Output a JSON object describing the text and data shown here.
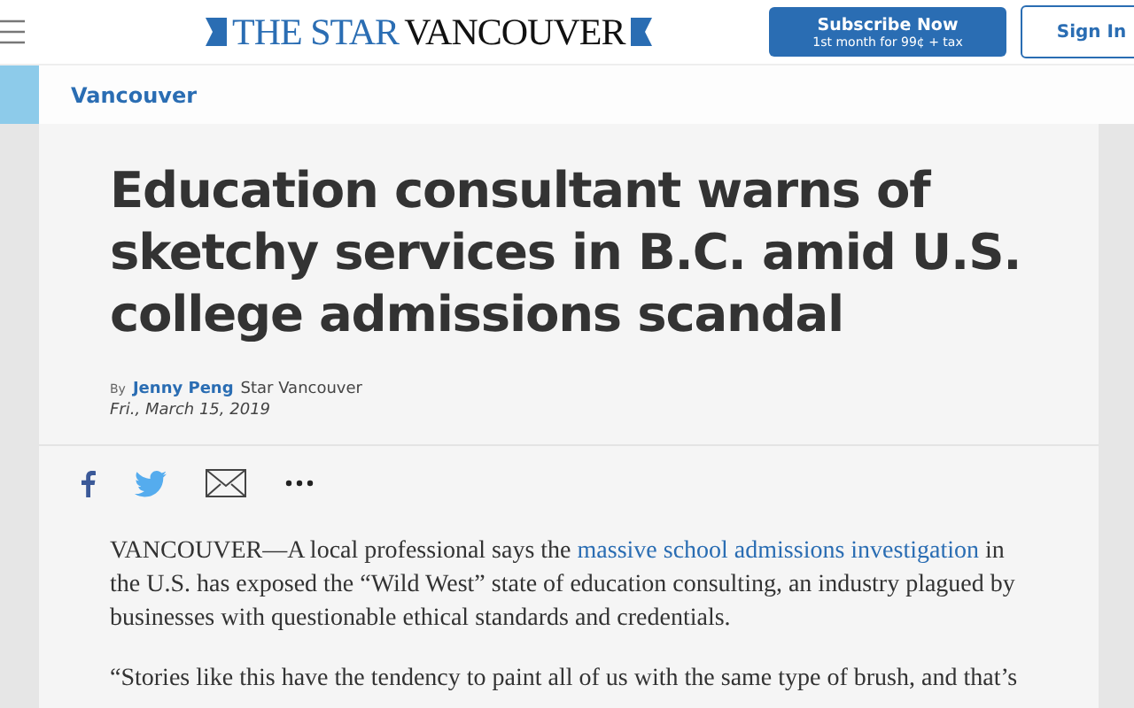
{
  "header": {
    "logo_left": "THE STAR",
    "logo_right": "VANCOUVER",
    "subscribe": {
      "title": "Subscribe Now",
      "subtitle": "1st month for 99¢ + tax"
    },
    "sign_in": "Sign In"
  },
  "section": "Vancouver",
  "article": {
    "headline": "Education consultant warns of sketchy services in B.C. amid U.S. college admissions scandal",
    "byline": {
      "prefix": "By",
      "author": "Jenny Peng",
      "outlet": "Star Vancouver",
      "date": "Fri., March 15, 2019"
    },
    "paragraphs": [
      {
        "before": "VANCOUVER—A local professional says the ",
        "link": "massive school admissions investigation",
        "after": " in the U.S. has exposed the “Wild West” state of education consulting, an industry plagued by businesses with questionable ethical standards and credentials."
      },
      {
        "before": "“Stories like this have the tendency to paint all of us with the same type of brush, and that’s"
      }
    ]
  }
}
